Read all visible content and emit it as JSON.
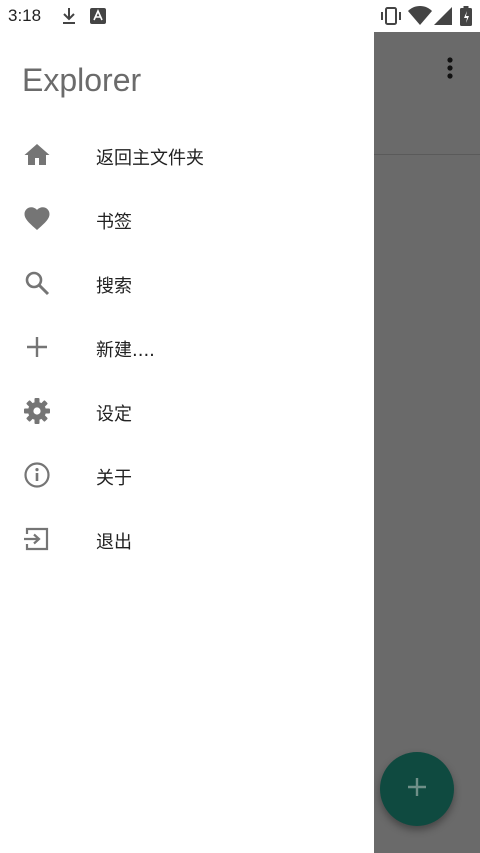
{
  "status_bar": {
    "time": "3:18",
    "icons": [
      "download-icon",
      "a-notification-icon",
      "vibrate-icon",
      "wifi-icon",
      "signal-icon",
      "battery-icon"
    ]
  },
  "drawer": {
    "title": "Explorer",
    "items": [
      {
        "label": "返回主文件夹",
        "icon": "home-icon"
      },
      {
        "label": "书签",
        "icon": "heart-icon"
      },
      {
        "label": "搜索",
        "icon": "search-icon"
      },
      {
        "label": "新建....",
        "icon": "plus-icon"
      },
      {
        "label": "设定",
        "icon": "gear-icon"
      },
      {
        "label": "关于",
        "icon": "info-icon"
      },
      {
        "label": "退出",
        "icon": "exit-icon"
      }
    ]
  },
  "colors": {
    "icon": "#757575",
    "scrim": "#6a6a6a",
    "fab": "#0f4a40"
  }
}
